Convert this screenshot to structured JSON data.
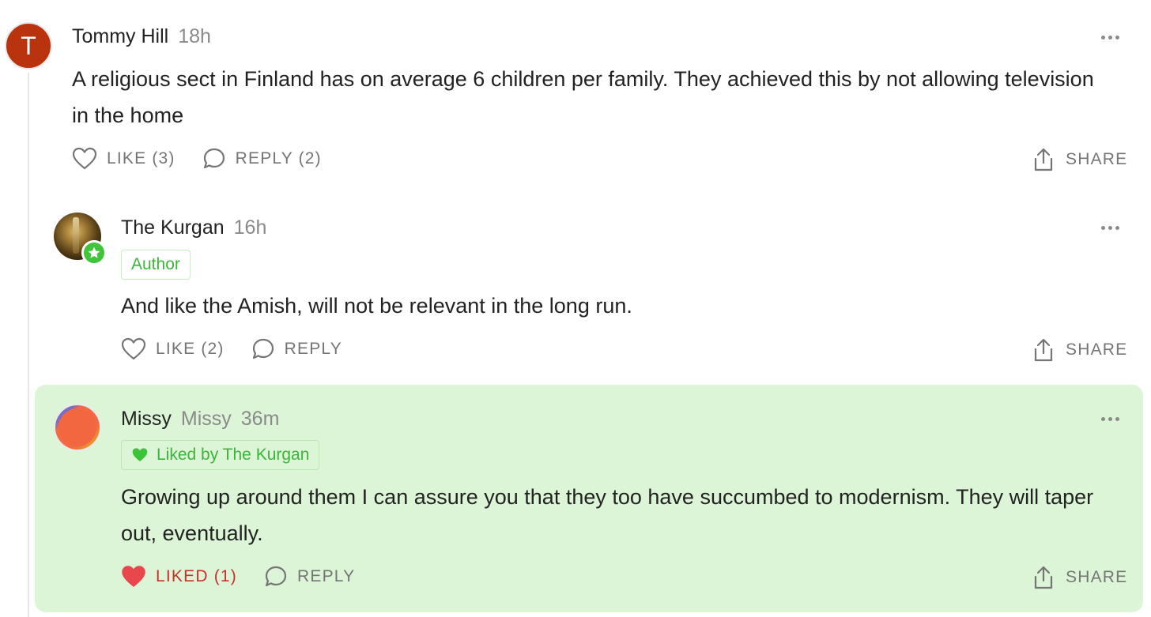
{
  "comments": [
    {
      "avatar_letter": "T",
      "name": "Tommy Hill",
      "time": "18h",
      "body": "A religious sect in Finland has on average 6 children per family. They achieved this by not allowing television in the home",
      "like_label": "LIKE (3)",
      "reply_label": "REPLY (2)",
      "share_label": "SHARE"
    },
    {
      "name": "The Kurgan",
      "time": "16h",
      "tag": "Author",
      "body": "And like the Amish, will not be relevant in the long run.",
      "like_label": "LIKE (2)",
      "reply_label": "REPLY",
      "share_label": "SHARE"
    },
    {
      "name": "Missy",
      "handle": "Missy",
      "time": "36m",
      "tag": "Liked by The Kurgan",
      "body": "Growing up around them I can assure you that they too have succumbed to modernism. They will taper out, eventually.",
      "like_label": "LIKED (1)",
      "reply_label": "REPLY",
      "share_label": "SHARE",
      "highlighted": true
    }
  ],
  "colors": {
    "highlight_bg": "#dcf5d6",
    "accent_green": "#3bb53a",
    "liked_red": "#c9302c",
    "avatar_red": "#b9330f"
  },
  "icons": [
    "heart-icon",
    "comment-bubble-icon",
    "share-icon",
    "more-icon",
    "star-icon"
  ]
}
